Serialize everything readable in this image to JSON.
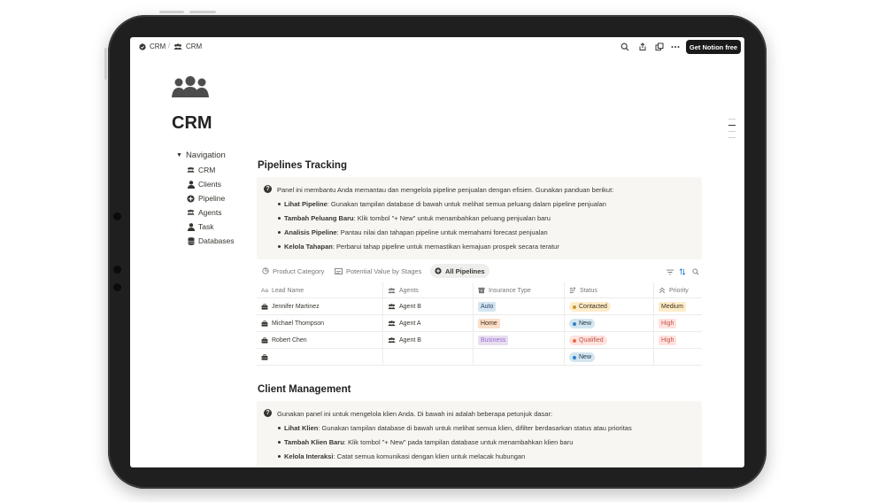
{
  "topbar": {
    "breadcrumb": [
      {
        "label": "CRM",
        "icon": "check-circle-icon"
      },
      {
        "label": "CRM",
        "icon": "people-icon"
      }
    ],
    "separator": "/",
    "get_notion_label": "Get Notion free"
  },
  "page": {
    "title": "CRM",
    "icon": "people-group-icon"
  },
  "navigation": {
    "heading": "Navigation",
    "items": [
      {
        "label": "CRM",
        "icon": "people-icon"
      },
      {
        "label": "Clients",
        "icon": "person-icon"
      },
      {
        "label": "Pipeline",
        "icon": "plus-circle-icon"
      },
      {
        "label": "Agents",
        "icon": "group-icon"
      },
      {
        "label": "Task",
        "icon": "person-icon"
      },
      {
        "label": "Databases",
        "icon": "database-icon"
      }
    ]
  },
  "pipelines": {
    "title": "Pipelines Tracking",
    "callout_intro": "Panel ini membantu Anda memantau dan mengelola pipeline penjualan dengan efisien. Gunakan panduan berikut:",
    "bullets": [
      {
        "bold": "Lihat Pipeline",
        "text": ": Gunakan tampilan database di bawah untuk melihat semua peluang dalam pipeline penjualan"
      },
      {
        "bold": "Tambah Peluang Baru",
        "text": ": Klik tombol \"+ New\" untuk menambahkan peluang penjualan baru"
      },
      {
        "bold": "Analisis Pipeline",
        "text": ": Pantau nilai dan tahapan pipeline untuk memahami forecast penjualan"
      },
      {
        "bold": "Kelola Tahapan",
        "text": ": Perbarui tahap pipeline untuk memastikan kemajuan prospek secara teratur"
      }
    ],
    "tabs": [
      {
        "label": "Product Category",
        "active": false
      },
      {
        "label": "Potential Value by Stages",
        "active": false
      },
      {
        "label": "All Pipelines",
        "active": true
      }
    ],
    "columns": [
      "Lead Name",
      "Agents",
      "Insurance Type",
      "Status",
      "Priority"
    ],
    "rows": [
      {
        "lead": "Jennifer Martinez",
        "agent": "Agent B",
        "type": "Auto",
        "status": "Contacted",
        "priority": "Medium"
      },
      {
        "lead": "Michael Thompson",
        "agent": "Agent A",
        "type": "Home",
        "status": "New",
        "priority": "High"
      },
      {
        "lead": "Robert Chen",
        "agent": "Agent B",
        "type": "Business",
        "status": "Qualified",
        "priority": "High"
      },
      {
        "lead": "",
        "agent": "",
        "type": "",
        "status": "New",
        "priority": ""
      }
    ]
  },
  "client_management": {
    "title": "Client Management",
    "callout_intro": "Gunakan panel ini untuk mengelola klien Anda. Di bawah ini adalah beberapa petunjuk dasar:",
    "bullets": [
      {
        "bold": "Lihat Klien",
        "text": ": Gunakan tampilan database di bawah untuk melihat semua klien, difilter berdasarkan status atau prioritas"
      },
      {
        "bold": "Tambah Klien Baru",
        "text": ": Klik tombol \"+ New\" pada tampilan database untuk menambahkan klien baru"
      },
      {
        "bold": "Kelola Interaksi",
        "text": ": Catat semua komunikasi dengan klien untuk melacak hubungan"
      }
    ]
  },
  "colors": {
    "auto": "#d3e5ef",
    "home": "#fadec9",
    "business": "#e8deee",
    "contacted_bg": "#fdecc8",
    "contacted_dot": "#cb912f",
    "new_bg": "#d3e5ef",
    "new_dot": "#2f7fc6",
    "qualified_bg": "#ffe2dd",
    "qualified_dot": "#e16f48",
    "medium_bg": "#fdecc8",
    "high_bg": "#ffe2dd",
    "high_text": "#c4554d"
  }
}
